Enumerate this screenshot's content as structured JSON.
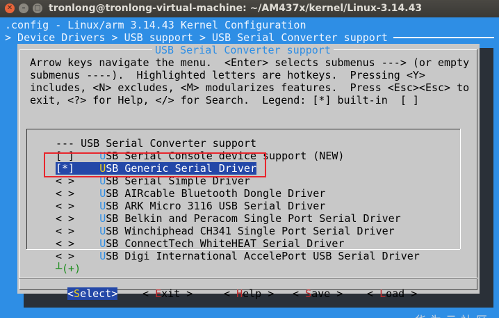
{
  "window": {
    "title": "tronlong@tronlong-virtual-machine: ~/AM437x/kernel/Linux-3.14.43"
  },
  "header": {
    "line1": ".config - Linux/arm 3.14.43 Kernel Configuration",
    "line2": "> Device Drivers > USB support > USB Serial Converter support"
  },
  "dialog": {
    "title": "USB Serial Converter support",
    "help_lines": [
      "Arrow keys navigate the menu.  <Enter> selects submenus ---> (or empty",
      "submenus ----).  Highlighted letters are hotkeys.  Pressing <Y>",
      "includes, <N> excludes, <M> modularizes features.  Press <Esc><Esc> to",
      "exit, <?> for Help, </> for Search.  Legend: [*] built-in  [ ]"
    ]
  },
  "menu": {
    "header": "--- USB Serial Converter support",
    "items": [
      {
        "state": "[ ]",
        "hot": "U",
        "rest": "SB Serial Console device support (NEW)"
      },
      {
        "state": "[*]",
        "hot": "U",
        "rest": "SB Generic Serial Driver"
      },
      {
        "state": "< >",
        "hot": "U",
        "rest": "SB Serial Simple Driver"
      },
      {
        "state": "< >",
        "hot": "U",
        "rest": "SB AIRcable Bluetooth Dongle Driver"
      },
      {
        "state": "< >",
        "hot": "U",
        "rest": "SB ARK Micro 3116 USB Serial Driver"
      },
      {
        "state": "< >",
        "hot": "U",
        "rest": "SB Belkin and Peracom Single Port Serial Driver"
      },
      {
        "state": "< >",
        "hot": "U",
        "rest": "SB Winchiphead CH341 Single Port Serial Driver"
      },
      {
        "state": "< >",
        "hot": "U",
        "rest": "SB ConnectTech WhiteHEAT Serial Driver"
      },
      {
        "state": "< >",
        "hot": "U",
        "rest": "SB Digi International AccelePort USB Serial Driver"
      }
    ],
    "more_indicator": "(+)"
  },
  "buttons": {
    "select": {
      "open": "<",
      "key": "S",
      "rest": "elect",
      "close": ">"
    },
    "exit": {
      "open": "< ",
      "key": "E",
      "rest": "xit",
      "close": " >"
    },
    "help": {
      "open": "< ",
      "key": "H",
      "rest": "elp",
      "close": " >"
    },
    "save": {
      "open": "< ",
      "key": "S",
      "rest": "ave",
      "close": " >"
    },
    "load": {
      "open": "< ",
      "key": "L",
      "rest": "oad",
      "close": " >"
    }
  },
  "watermark": "华为云社区",
  "colors": {
    "terminal_bg": "#2e8ee5",
    "dialog_bg": "#c8c8c8",
    "selection_bg": "#2448a8",
    "hotkey": "#2e8ee5",
    "highlight_box": "#e8262d"
  }
}
